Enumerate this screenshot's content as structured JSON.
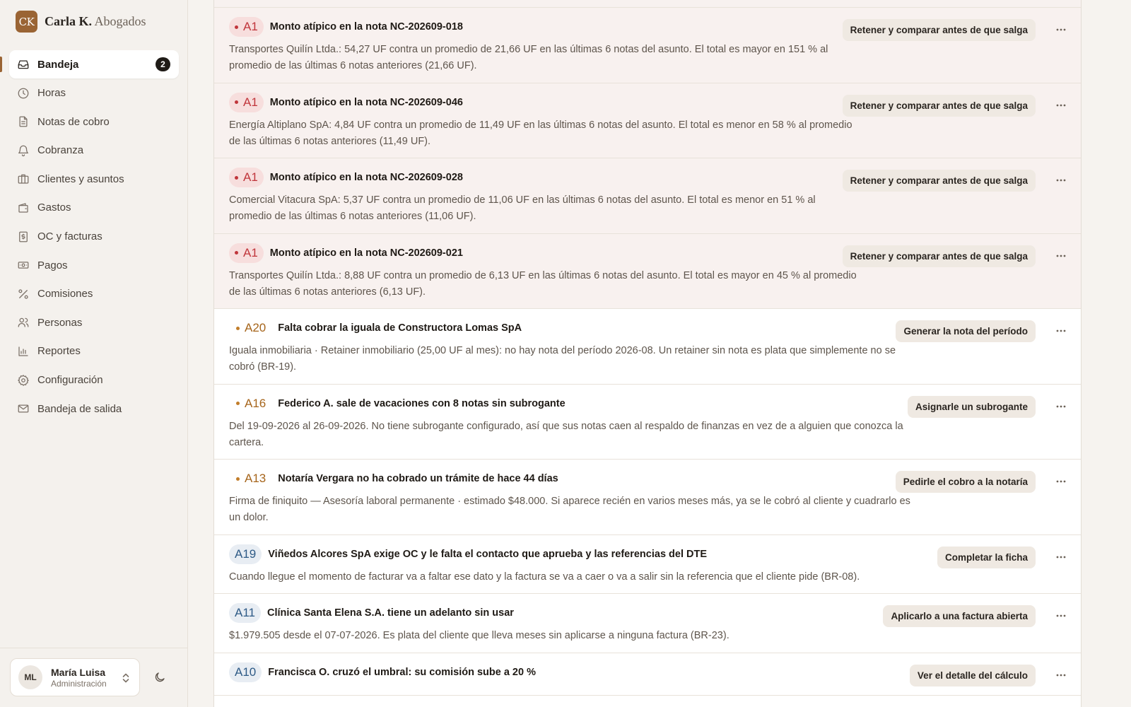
{
  "brand": {
    "logo": "CK",
    "name_bold": "Carla K.",
    "name_light": "Abogados"
  },
  "nav": [
    {
      "label": "Bandeja",
      "icon": "inbox-icon",
      "badge": "2",
      "active": true
    },
    {
      "label": "Horas",
      "icon": "clock-icon"
    },
    {
      "label": "Notas de cobro",
      "icon": "document-icon"
    },
    {
      "label": "Cobranza",
      "icon": "bell-icon"
    },
    {
      "label": "Clientes y asuntos",
      "icon": "briefcase-icon"
    },
    {
      "label": "Gastos",
      "icon": "wallet-icon"
    },
    {
      "label": "OC y facturas",
      "icon": "invoice-icon"
    },
    {
      "label": "Pagos",
      "icon": "banknote-icon"
    },
    {
      "label": "Comisiones",
      "icon": "percent-icon"
    },
    {
      "label": "Personas",
      "icon": "people-icon"
    },
    {
      "label": "Reportes",
      "icon": "bar-chart-icon"
    },
    {
      "label": "Configuración",
      "icon": "gear-icon"
    },
    {
      "label": "Bandeja de salida",
      "icon": "mail-icon"
    }
  ],
  "user": {
    "initials": "ML",
    "name": "María Luisa",
    "role": "Administración"
  },
  "rows": [
    {
      "code": "A1",
      "tone": "red",
      "title": "Monto atípico en la nota NC-202609-018",
      "lines": [
        "Transportes Quilín Ltda.: 54,27 UF contra un promedio de 21,66 UF en las últimas 6 notas del asunto. El total es mayor en 151 % al",
        "promedio de las últimas 6 notas anteriores (21,66 UF)."
      ],
      "action": "Retener y comparar antes de que salga"
    },
    {
      "code": "A1",
      "tone": "red",
      "title": "Monto atípico en la nota NC-202609-046",
      "lines": [
        "Energía Altiplano SpA: 4,84 UF contra un promedio de 11,49 UF en las últimas 6 notas del asunto. El total es menor en 58 % al promedio",
        "de las últimas 6 notas anteriores (11,49 UF)."
      ],
      "action": "Retener y comparar antes de que salga"
    },
    {
      "code": "A1",
      "tone": "red",
      "title": "Monto atípico en la nota NC-202609-028",
      "lines": [
        "Comercial Vitacura SpA: 5,37 UF contra un promedio de 11,06 UF en las últimas 6 notas del asunto. El total es menor en 51 % al",
        "promedio de las últimas 6 notas anteriores (11,06 UF)."
      ],
      "action": "Retener y comparar antes de que salga"
    },
    {
      "code": "A1",
      "tone": "red",
      "title": "Monto atípico en la nota NC-202609-021",
      "lines": [
        "Transportes Quilín Ltda.: 8,88 UF contra un promedio de 6,13 UF en las últimas 6 notas del asunto. El total es mayor en 45 % al promedio",
        "de las últimas 6 notas anteriores (6,13 UF)."
      ],
      "action": "Retener y comparar antes de que salga"
    },
    {
      "code": "A20",
      "tone": "amber",
      "title": "Falta cobrar la iguala de Constructora Lomas SpA",
      "lines": [
        "Iguala inmobiliaria · Retainer inmobiliario (25,00 UF al mes): no hay nota del período 2026-08. Un retainer sin nota es plata que simplemente no se",
        "cobró (BR-19)."
      ],
      "action": "Generar la nota del período"
    },
    {
      "code": "A16",
      "tone": "amber",
      "title": "Federico A. sale de vacaciones con 8 notas sin subrogante",
      "lines": [
        "Del 19-09-2026 al 26-09-2026. No tiene subrogante configurado, así que sus notas caen al respaldo de finanzas en vez de a alguien que conozca la",
        "cartera."
      ],
      "action": "Asignarle un subrogante"
    },
    {
      "code": "A13",
      "tone": "amber",
      "title": "Notaría Vergara no ha cobrado un trámite de hace 44 días",
      "lines": [
        "Firma de finiquito — Asesoría laboral permanente · estimado $48.000. Si aparece recién en varios meses más, ya se le cobró al cliente y cuadrarlo es",
        "un dolor."
      ],
      "action": "Pedirle el cobro a la notaría"
    },
    {
      "code": "A19",
      "tone": "blue",
      "title": "Viñedos Alcores SpA exige OC y le falta el contacto que aprueba y las referencias del DTE",
      "lines": [
        "Cuando llegue el momento de facturar va a faltar ese dato y la factura se va a caer o va a salir sin la referencia que el cliente pide (BR-08)."
      ],
      "action": "Completar la ficha"
    },
    {
      "code": "A11",
      "tone": "blue",
      "title": "Clínica Santa Elena S.A. tiene un adelanto sin usar",
      "lines": [
        "$1.979.505 desde el 07-07-2026. Es plata del cliente que lleva meses sin aplicarse a ninguna factura (BR-23)."
      ],
      "action": "Aplicarlo a una factura abierta"
    },
    {
      "code": "A10",
      "tone": "blue",
      "title": "Francisca O. cruzó el umbral: su comisión sube a 20 %",
      "lines": [],
      "action": "Ver el detalle del cálculo"
    }
  ]
}
